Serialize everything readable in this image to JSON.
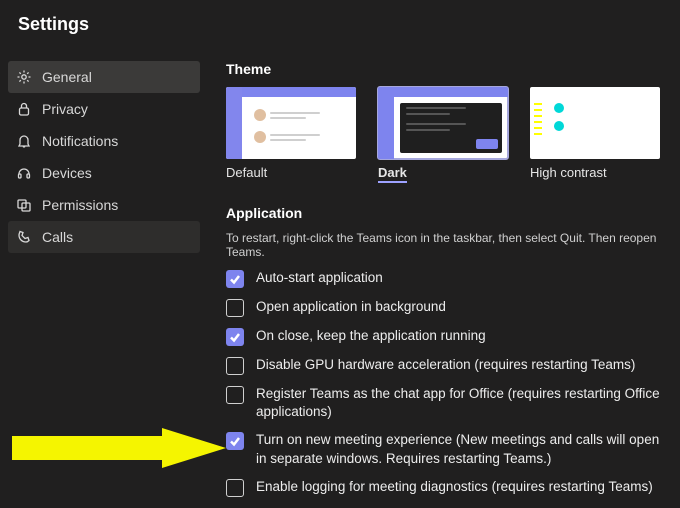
{
  "title": "Settings",
  "sidebar": {
    "items": [
      {
        "label": "General",
        "icon": "gear-icon",
        "active": true,
        "hover": false
      },
      {
        "label": "Privacy",
        "icon": "lock-icon",
        "active": false,
        "hover": false
      },
      {
        "label": "Notifications",
        "icon": "bell-icon",
        "active": false,
        "hover": false
      },
      {
        "label": "Devices",
        "icon": "headset-icon",
        "active": false,
        "hover": false
      },
      {
        "label": "Permissions",
        "icon": "permissions-icon",
        "active": false,
        "hover": false
      },
      {
        "label": "Calls",
        "icon": "phone-icon",
        "active": false,
        "hover": true
      }
    ]
  },
  "sections": {
    "theme": {
      "heading": "Theme",
      "options": [
        {
          "label": "Default",
          "selected": false,
          "kind": "default"
        },
        {
          "label": "Dark",
          "selected": true,
          "kind": "dark"
        },
        {
          "label": "High contrast",
          "selected": false,
          "kind": "hc"
        }
      ]
    },
    "application": {
      "heading": "Application",
      "hint": "To restart, right-click the Teams icon in the taskbar, then select Quit. Then reopen Teams.",
      "options": [
        {
          "checked": true,
          "label": "Auto-start application"
        },
        {
          "checked": false,
          "label": "Open application in background"
        },
        {
          "checked": true,
          "label": "On close, keep the application running"
        },
        {
          "checked": false,
          "label": "Disable GPU hardware acceleration (requires restarting Teams)"
        },
        {
          "checked": false,
          "label": "Register Teams as the chat app for Office (requires restarting Office applications)"
        },
        {
          "checked": true,
          "label": "Turn on new meeting experience (New meetings and calls will open in separate windows. Requires restarting Teams.)"
        },
        {
          "checked": false,
          "label": "Enable logging for meeting diagnostics (requires restarting Teams)"
        }
      ]
    }
  },
  "annotation": {
    "arrow_color": "#F5F500"
  }
}
